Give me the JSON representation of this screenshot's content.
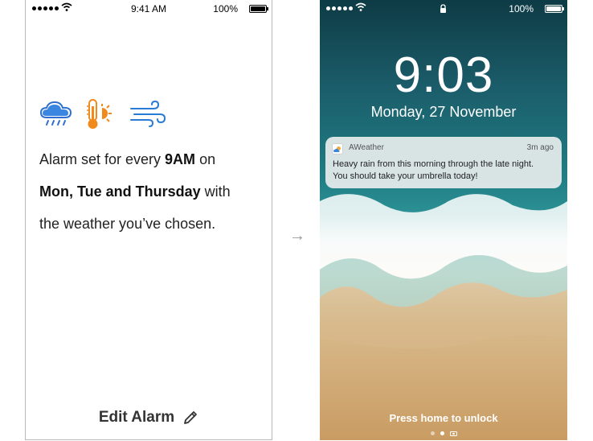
{
  "left_phone": {
    "status": {
      "time": "9:41 AM",
      "battery": "100%"
    },
    "weather_icons": [
      "rain-cloud-icon",
      "thermometer-sun-icon",
      "wind-icon"
    ],
    "alarm": {
      "line1_pre": "Alarm set for every ",
      "line1_bold": "9AM",
      "line1_post": " on",
      "line2_bold": "Mon, Tue and Thursday",
      "line2_post": " with",
      "line3": "the weather you’ve chosen."
    },
    "edit_label": "Edit Alarm"
  },
  "arrow_glyph": "→",
  "right_phone": {
    "status": {
      "battery": "100%"
    },
    "time": "9:03",
    "date": "Monday, 27 November",
    "notification": {
      "app": "AWeather",
      "ago": "3m ago",
      "line1": "Heavy rain from this morning through the late night.",
      "line2": "You should take your umbrella today!"
    },
    "unlock_hint": "Press home to unlock"
  },
  "colors": {
    "rain_blue": "#2f6fd1",
    "sun_orange": "#f08a1c",
    "wind_blue": "#2a7bd5"
  }
}
